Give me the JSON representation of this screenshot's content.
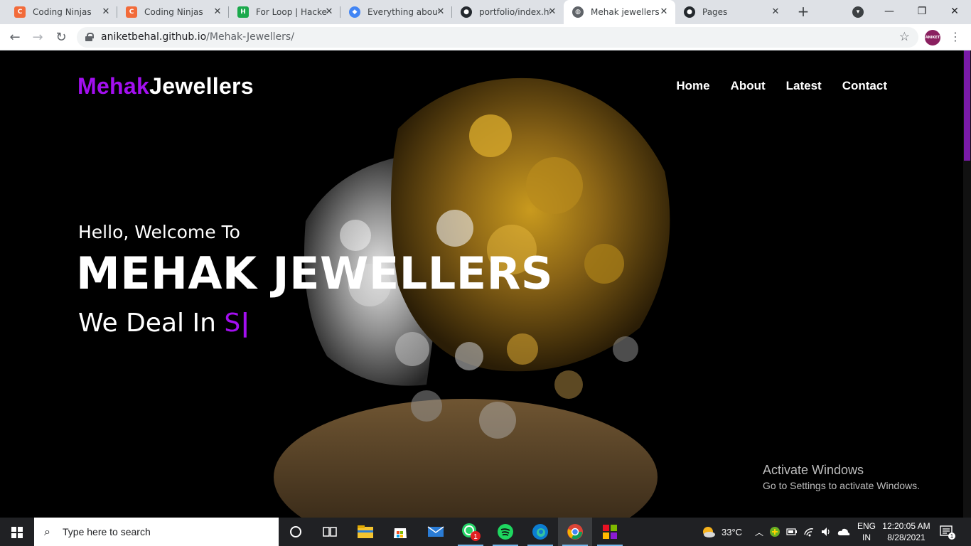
{
  "browser": {
    "tabs": [
      {
        "title": "Coding Ninjas",
        "favicon_color": "#f26b3a",
        "favicon_glyph": "C"
      },
      {
        "title": "Coding Ninjas",
        "favicon_color": "#f26b3a",
        "favicon_glyph": "C"
      },
      {
        "title": "For Loop | Hacker",
        "favicon_color": "#1ba94c",
        "favicon_glyph": "H"
      },
      {
        "title": "Everything about",
        "favicon_color": "#4285f4",
        "favicon_glyph": "◆"
      },
      {
        "title": "portfolio/index.ht",
        "favicon_color": "#24292e",
        "favicon_glyph": "●"
      },
      {
        "title": "Mehak jewellers",
        "favicon_color": "#5f6368",
        "favicon_glyph": "◍"
      },
      {
        "title": "Pages",
        "favicon_color": "#24292e",
        "favicon_glyph": "●"
      }
    ],
    "close_glyph": "✕",
    "new_tab_glyph": "+",
    "url_host": "aniketbehal.github.io",
    "url_path": "/Mehak-Jewellers/",
    "profile_text": "ANIKET BEHAL"
  },
  "site": {
    "logo_accent": "Mehak",
    "logo_rest": "Jewellers",
    "nav": [
      "Home",
      "About",
      "Latest",
      "Contact"
    ],
    "hello": "Hello, Welcome To",
    "title": "MEHAK JEWELLERS",
    "deal_prefix": "We Deal In ",
    "deal_typed": "S",
    "cursor": "|",
    "accent_color": "#a30ff0"
  },
  "watermark": {
    "line1": "Activate Windows",
    "line2": "Go to Settings to activate Windows."
  },
  "taskbar": {
    "search_placeholder": "Type here to search",
    "weather": "33°C",
    "lang_top": "ENG",
    "lang_bottom": "IN",
    "time": "12:20:05 AM",
    "date": "8/28/2021",
    "notification_count": "1",
    "whatsapp_badge": "1"
  }
}
